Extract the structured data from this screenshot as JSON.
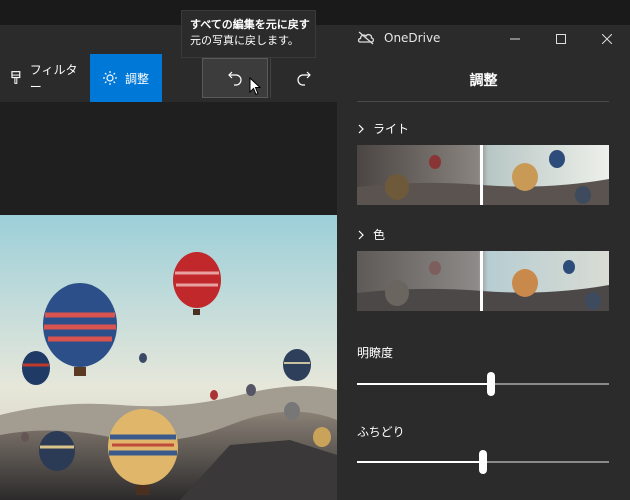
{
  "window": {
    "title": "OneDrive"
  },
  "toolbar": {
    "filter_label": "フィルター",
    "adjust_label": "調整"
  },
  "tooltip": {
    "title": "すべての編集を元に戻す",
    "description": "元の写真に戻します。"
  },
  "panel": {
    "title": "調整",
    "sections": [
      {
        "label": "ライト"
      },
      {
        "label": "色"
      }
    ],
    "sliders": [
      {
        "label": "明瞭度",
        "value": 0.53
      },
      {
        "label": "ふちどり",
        "value": 0.5
      }
    ]
  },
  "colors": {
    "accent": "#0078d7",
    "panel_bg": "#2b2b2b",
    "app_bg": "#1f1f1f"
  }
}
